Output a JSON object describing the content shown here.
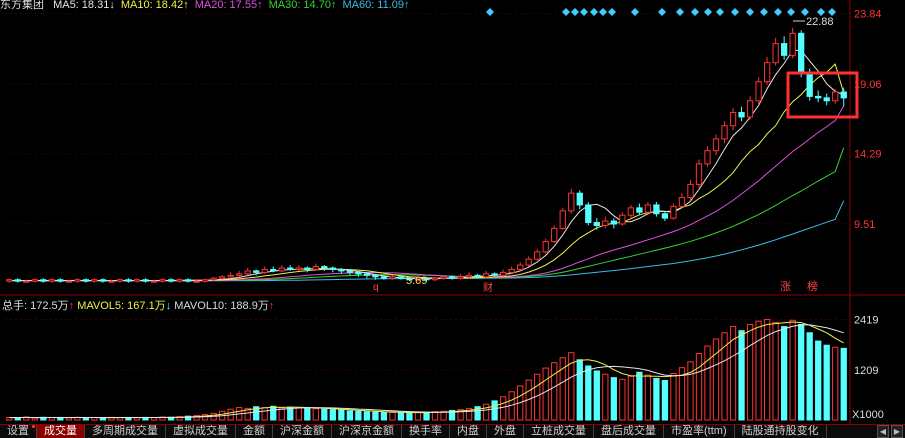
{
  "header": {
    "stock_name": "东方集团",
    "ma_items": [
      {
        "label": "MA5:",
        "value": "18.31",
        "arrow": "↓",
        "color": "#e6e6e6"
      },
      {
        "label": "MA10:",
        "value": "18.42",
        "arrow": "↑",
        "color": "#f0f04a"
      },
      {
        "label": "MA20:",
        "value": "17.55",
        "arrow": "↑",
        "color": "#e050e0"
      },
      {
        "label": "MA30:",
        "value": "14.70",
        "arrow": "↑",
        "color": "#33d633"
      },
      {
        "label": "MA60:",
        "value": "11.09",
        "arrow": "↑",
        "color": "#3fbbe6"
      }
    ]
  },
  "volume_header": {
    "total_label": "总手:",
    "total_value": "172.5万",
    "total_arrow": "↑",
    "mavol5_label": "MAVOL5:",
    "mavol5_value": "167.1万",
    "mavol5_arrow": "↓",
    "mavol10_label": "MAVOL10:",
    "mavol10_value": "188.9万",
    "mavol10_arrow": "↑"
  },
  "markers": {
    "high": "22.88",
    "low": "5.69",
    "tag_q": "q",
    "tag_cai": "财",
    "tag_zhang": "涨",
    "tag_bang": "榜"
  },
  "price_axis": [
    "23.84",
    "19.06",
    "14.29",
    "9.51"
  ],
  "volume_axis": [
    "2419",
    "1209",
    "X1000"
  ],
  "colors": {
    "up": "#ff3333",
    "down": "#54ffff",
    "ma5": "#e6e6e6",
    "ma10": "#f0f04a",
    "ma20": "#e050e0",
    "ma30": "#33d633",
    "ma60": "#3fbbe6",
    "axis": "#8a0000",
    "highlight": "#ff3030"
  },
  "tabs": [
    {
      "label": "设置",
      "active": false,
      "dot": true
    },
    {
      "label": "成交量",
      "active": true,
      "dot": false
    },
    {
      "label": "多周期成交量",
      "active": false,
      "dot": false
    },
    {
      "label": "虚拟成交量",
      "active": false,
      "dot": false
    },
    {
      "label": "金额",
      "active": false,
      "dot": false
    },
    {
      "label": "沪深金额",
      "active": false,
      "dot": false
    },
    {
      "label": "沪深京金额",
      "active": false,
      "dot": false
    },
    {
      "label": "换手率",
      "active": false,
      "dot": false
    },
    {
      "label": "内盘",
      "active": false,
      "dot": false
    },
    {
      "label": "外盘",
      "active": false,
      "dot": false
    },
    {
      "label": "立桩成交量",
      "active": false,
      "dot": false
    },
    {
      "label": "盘后成交量",
      "active": false,
      "dot": false
    },
    {
      "label": "市盈率(ttm)",
      "active": false,
      "dot": false
    },
    {
      "label": "陆股通持股变化",
      "active": false,
      "dot": false
    }
  ],
  "chart_data": {
    "type": "candlestick",
    "price_ylim": [
      5.0,
      24.5
    ],
    "volume_ylim": [
      0,
      2600
    ],
    "volume_unit": "X1000",
    "candles": [
      [
        5.6,
        5.7,
        5.8,
        5.5
      ],
      [
        5.7,
        5.6,
        5.8,
        5.5
      ],
      [
        5.6,
        5.6,
        5.7,
        5.5
      ],
      [
        5.6,
        5.7,
        5.8,
        5.5
      ],
      [
        5.7,
        5.6,
        5.8,
        5.5
      ],
      [
        5.6,
        5.7,
        5.8,
        5.5
      ],
      [
        5.7,
        5.6,
        5.8,
        5.5
      ],
      [
        5.6,
        5.6,
        5.7,
        5.5
      ],
      [
        5.6,
        5.7,
        5.8,
        5.5
      ],
      [
        5.7,
        5.6,
        5.8,
        5.5
      ],
      [
        5.6,
        5.7,
        5.8,
        5.5
      ],
      [
        5.7,
        5.6,
        5.8,
        5.5
      ],
      [
        5.6,
        5.6,
        5.7,
        5.5
      ],
      [
        5.6,
        5.7,
        5.8,
        5.5
      ],
      [
        5.7,
        5.6,
        5.8,
        5.5
      ],
      [
        5.6,
        5.7,
        5.8,
        5.5
      ],
      [
        5.7,
        5.6,
        5.8,
        5.5
      ],
      [
        5.6,
        5.6,
        5.7,
        5.5
      ],
      [
        5.6,
        5.7,
        5.8,
        5.5
      ],
      [
        5.7,
        5.6,
        5.8,
        5.5
      ],
      [
        5.6,
        5.7,
        5.8,
        5.5
      ],
      [
        5.7,
        5.6,
        5.8,
        5.5
      ],
      [
        5.6,
        5.6,
        5.7,
        5.5
      ],
      [
        5.6,
        5.7,
        5.8,
        5.5
      ],
      [
        5.7,
        5.8,
        5.9,
        5.6
      ],
      [
        5.8,
        5.9,
        6.0,
        5.7
      ],
      [
        5.9,
        6.0,
        6.2,
        5.8
      ],
      [
        6.0,
        6.1,
        6.3,
        5.9
      ],
      [
        6.1,
        6.3,
        6.5,
        6.0
      ],
      [
        6.3,
        6.2,
        6.4,
        6.0
      ],
      [
        6.2,
        6.4,
        6.6,
        6.1
      ],
      [
        6.4,
        6.3,
        6.6,
        6.2
      ],
      [
        6.3,
        6.5,
        6.7,
        6.2
      ],
      [
        6.5,
        6.4,
        6.7,
        6.3
      ],
      [
        6.4,
        6.5,
        6.7,
        6.3
      ],
      [
        6.5,
        6.4,
        6.6,
        6.2
      ],
      [
        6.4,
        6.6,
        6.8,
        6.3
      ],
      [
        6.6,
        6.5,
        6.7,
        6.3
      ],
      [
        6.5,
        6.4,
        6.6,
        6.2
      ],
      [
        6.4,
        6.3,
        6.5,
        6.1
      ],
      [
        6.3,
        6.2,
        6.4,
        6.0
      ],
      [
        6.2,
        6.1,
        6.3,
        5.9
      ],
      [
        6.1,
        6.0,
        6.2,
        5.8
      ],
      [
        6.0,
        5.9,
        6.1,
        5.7
      ],
      [
        5.9,
        5.8,
        6.0,
        5.7
      ],
      [
        5.8,
        5.9,
        6.0,
        5.7
      ],
      [
        5.9,
        5.8,
        6.0,
        5.7
      ],
      [
        5.8,
        5.7,
        5.9,
        5.6
      ],
      [
        5.7,
        5.8,
        5.9,
        5.6
      ],
      [
        5.8,
        5.7,
        5.9,
        5.6
      ],
      [
        5.7,
        5.8,
        5.9,
        5.6
      ],
      [
        5.8,
        5.9,
        6.0,
        5.7
      ],
      [
        5.9,
        5.8,
        6.0,
        5.7
      ],
      [
        5.8,
        5.9,
        6.1,
        5.7
      ],
      [
        5.9,
        6.0,
        6.2,
        5.8
      ],
      [
        6.0,
        5.9,
        6.1,
        5.8
      ],
      [
        5.9,
        6.1,
        6.3,
        5.8
      ],
      [
        6.1,
        6.0,
        6.2,
        5.9
      ],
      [
        6.0,
        6.2,
        6.4,
        5.9
      ],
      [
        6.2,
        6.4,
        6.6,
        6.1
      ],
      [
        6.4,
        6.7,
        6.9,
        6.3
      ],
      [
        6.7,
        7.1,
        7.3,
        6.6
      ],
      [
        7.1,
        7.6,
        7.8,
        7.0
      ],
      [
        7.6,
        8.3,
        8.5,
        7.5
      ],
      [
        8.3,
        9.2,
        9.4,
        8.2
      ],
      [
        9.2,
        10.4,
        10.6,
        9.1
      ],
      [
        10.4,
        11.6,
        11.9,
        10.2
      ],
      [
        11.6,
        10.8,
        11.8,
        10.5
      ],
      [
        10.8,
        9.6,
        11.0,
        9.4
      ],
      [
        9.6,
        9.4,
        9.9,
        9.1
      ],
      [
        9.4,
        9.7,
        10.0,
        9.2
      ],
      [
        9.7,
        9.5,
        9.9,
        9.2
      ],
      [
        9.5,
        10.1,
        10.3,
        9.4
      ],
      [
        10.1,
        10.6,
        10.8,
        9.9
      ],
      [
        10.6,
        10.3,
        10.9,
        10.1
      ],
      [
        10.3,
        10.8,
        11.0,
        10.1
      ],
      [
        10.8,
        10.2,
        11.0,
        10.0
      ],
      [
        10.2,
        9.9,
        10.4,
        9.7
      ],
      [
        9.9,
        10.7,
        10.9,
        9.8
      ],
      [
        10.7,
        11.3,
        11.6,
        10.6
      ],
      [
        11.3,
        12.2,
        12.5,
        11.1
      ],
      [
        12.2,
        13.6,
        13.9,
        12.0
      ],
      [
        13.6,
        14.5,
        14.8,
        13.4
      ],
      [
        14.5,
        15.3,
        15.6,
        14.2
      ],
      [
        15.3,
        16.2,
        16.5,
        15.0
      ],
      [
        16.2,
        17.1,
        17.4,
        15.9
      ],
      [
        17.1,
        16.8,
        17.5,
        16.5
      ],
      [
        16.8,
        17.9,
        18.2,
        16.6
      ],
      [
        17.9,
        19.2,
        19.5,
        17.7
      ],
      [
        19.2,
        20.5,
        20.9,
        19.0
      ],
      [
        20.5,
        21.8,
        22.2,
        20.3
      ],
      [
        21.8,
        21.0,
        22.3,
        20.7
      ],
      [
        21.0,
        22.5,
        22.88,
        20.8
      ],
      [
        22.5,
        19.8,
        22.7,
        19.5
      ],
      [
        19.8,
        18.2,
        20.1,
        17.9
      ],
      [
        18.2,
        18.1,
        18.6,
        17.8
      ],
      [
        18.1,
        17.9,
        18.4,
        17.6
      ],
      [
        17.9,
        18.5,
        18.7,
        17.7
      ],
      [
        18.5,
        18.1,
        18.8,
        17.5
      ]
    ],
    "volumes": [
      60,
      55,
      70,
      50,
      65,
      58,
      62,
      54,
      66,
      57,
      60,
      52,
      64,
      59,
      61,
      56,
      63,
      58,
      70,
      66,
      80,
      92,
      110,
      130,
      160,
      210,
      260,
      300,
      280,
      320,
      300,
      330,
      290,
      310,
      300,
      280,
      270,
      260,
      250,
      240,
      220,
      210,
      200,
      190,
      185,
      180,
      175,
      170,
      180,
      190,
      200,
      210,
      230,
      250,
      280,
      320,
      380,
      460,
      560,
      680,
      820,
      960,
      1100,
      1250,
      1380,
      1500,
      1620,
      1450,
      1300,
      1180,
      1100,
      1020,
      980,
      1050,
      1150,
      1080,
      1000,
      950,
      1120,
      1260,
      1400,
      1600,
      1780,
      1950,
      2100,
      2250,
      2150,
      2300,
      2380,
      2419,
      2350,
      2250,
      2400,
      2300,
      2100,
      1900,
      1800,
      1750,
      1725
    ],
    "ma": {
      "ma5": [
        5.65,
        5.65,
        5.65,
        5.65,
        5.65,
        5.65,
        5.65,
        5.65,
        5.65,
        5.65,
        5.65,
        5.65,
        5.65,
        5.65,
        5.65,
        5.65,
        5.65,
        5.65,
        5.65,
        5.65,
        5.66,
        5.66,
        5.66,
        5.67,
        5.68,
        5.72,
        5.78,
        5.86,
        5.98,
        6.1,
        6.2,
        6.28,
        6.36,
        6.4,
        6.42,
        6.44,
        6.46,
        6.46,
        6.44,
        6.4,
        6.34,
        6.26,
        6.16,
        6.06,
        5.96,
        5.88,
        5.84,
        5.8,
        5.78,
        5.78,
        5.78,
        5.8,
        5.82,
        5.84,
        5.88,
        5.92,
        5.96,
        6.0,
        6.06,
        6.14,
        6.3,
        6.56,
        6.9,
        7.36,
        7.98,
        8.74,
        9.66,
        10.36,
        10.76,
        10.84,
        10.58,
        10.06,
        9.66,
        9.66,
        9.88,
        10.2,
        10.4,
        10.36,
        10.3,
        10.62,
        11.06,
        11.86,
        12.74,
        13.62,
        14.6,
        15.52,
        16.06,
        16.78,
        17.58,
        18.72,
        19.68,
        20.44,
        21.36,
        21.32,
        20.62,
        19.92,
        19.06,
        18.54,
        18.31
      ],
      "ma10": [
        5.65,
        5.65,
        5.65,
        5.65,
        5.65,
        5.65,
        5.65,
        5.65,
        5.65,
        5.65,
        5.65,
        5.65,
        5.65,
        5.65,
        5.65,
        5.65,
        5.65,
        5.65,
        5.65,
        5.65,
        5.65,
        5.65,
        5.66,
        5.66,
        5.67,
        5.69,
        5.72,
        5.76,
        5.82,
        5.88,
        5.96,
        6.03,
        6.11,
        6.19,
        6.26,
        6.32,
        6.37,
        6.41,
        6.42,
        6.41,
        6.39,
        6.36,
        6.31,
        6.23,
        6.14,
        6.05,
        5.97,
        5.91,
        5.87,
        5.84,
        5.82,
        5.81,
        5.81,
        5.81,
        5.82,
        5.84,
        5.86,
        5.89,
        5.92,
        5.96,
        6.06,
        6.22,
        6.43,
        6.7,
        7.06,
        7.51,
        8.07,
        8.55,
        8.9,
        9.24,
        9.44,
        9.56,
        9.61,
        9.86,
        10.13,
        10.27,
        10.36,
        10.35,
        10.38,
        10.63,
        10.81,
        11.24,
        11.55,
        11.96,
        12.43,
        13.0,
        13.8,
        14.44,
        14.92,
        15.64,
        16.2,
        17.14,
        17.84,
        18.32,
        18.98,
        19.48,
        19.84,
        20.4,
        18.42
      ],
      "ma20": [
        5.64,
        5.64,
        5.64,
        5.64,
        5.64,
        5.64,
        5.64,
        5.64,
        5.64,
        5.64,
        5.64,
        5.64,
        5.64,
        5.64,
        5.64,
        5.64,
        5.64,
        5.64,
        5.64,
        5.64,
        5.64,
        5.64,
        5.64,
        5.65,
        5.65,
        5.66,
        5.67,
        5.69,
        5.71,
        5.74,
        5.77,
        5.81,
        5.85,
        5.9,
        5.95,
        6.0,
        6.04,
        6.08,
        6.11,
        6.14,
        6.16,
        6.18,
        6.19,
        6.19,
        6.18,
        6.17,
        6.14,
        6.11,
        6.07,
        6.03,
        6.0,
        5.96,
        5.93,
        5.9,
        5.88,
        5.86,
        5.85,
        5.85,
        5.86,
        5.88,
        5.92,
        5.98,
        6.06,
        6.16,
        6.3,
        6.47,
        6.69,
        6.92,
        7.13,
        7.35,
        7.55,
        7.73,
        7.89,
        8.06,
        8.24,
        8.42,
        8.6,
        8.79,
        8.98,
        9.21,
        9.45,
        9.75,
        10.05,
        10.36,
        10.73,
        11.11,
        11.55,
        12.0,
        12.44,
        12.95,
        13.44,
        13.94,
        14.44,
        14.86,
        15.3,
        15.74,
        16.14,
        16.56,
        17.55
      ],
      "ma30": [
        5.64,
        5.64,
        5.64,
        5.64,
        5.64,
        5.64,
        5.64,
        5.64,
        5.64,
        5.64,
        5.64,
        5.64,
        5.64,
        5.64,
        5.64,
        5.64,
        5.64,
        5.64,
        5.64,
        5.64,
        5.64,
        5.64,
        5.64,
        5.64,
        5.64,
        5.65,
        5.65,
        5.66,
        5.67,
        5.69,
        5.71,
        5.73,
        5.75,
        5.78,
        5.81,
        5.84,
        5.87,
        5.9,
        5.93,
        5.96,
        5.98,
        6.0,
        6.02,
        6.03,
        6.04,
        6.04,
        6.04,
        6.03,
        6.02,
        6.01,
        5.99,
        5.97,
        5.95,
        5.93,
        5.91,
        5.9,
        5.89,
        5.88,
        5.88,
        5.88,
        5.9,
        5.93,
        5.97,
        6.03,
        6.11,
        6.21,
        6.33,
        6.47,
        6.61,
        6.75,
        6.89,
        7.03,
        7.16,
        7.3,
        7.44,
        7.58,
        7.72,
        7.86,
        8.0,
        8.16,
        8.32,
        8.5,
        8.69,
        8.89,
        9.11,
        9.34,
        9.6,
        9.87,
        10.14,
        10.45,
        10.77,
        11.1,
        11.44,
        11.76,
        12.09,
        12.43,
        12.75,
        13.08,
        14.7
      ],
      "ma60": [
        5.63,
        5.63,
        5.63,
        5.63,
        5.63,
        5.63,
        5.63,
        5.63,
        5.63,
        5.63,
        5.63,
        5.63,
        5.63,
        5.63,
        5.63,
        5.63,
        5.63,
        5.63,
        5.63,
        5.63,
        5.63,
        5.63,
        5.63,
        5.63,
        5.63,
        5.63,
        5.63,
        5.64,
        5.64,
        5.64,
        5.65,
        5.65,
        5.66,
        5.66,
        5.67,
        5.68,
        5.69,
        5.7,
        5.71,
        5.72,
        5.73,
        5.74,
        5.75,
        5.76,
        5.77,
        5.77,
        5.78,
        5.78,
        5.79,
        5.79,
        5.79,
        5.8,
        5.8,
        5.8,
        5.8,
        5.8,
        5.81,
        5.81,
        5.81,
        5.82,
        5.83,
        5.85,
        5.87,
        5.9,
        5.94,
        5.98,
        6.03,
        6.09,
        6.15,
        6.21,
        6.27,
        6.33,
        6.39,
        6.46,
        6.53,
        6.6,
        6.67,
        6.74,
        6.81,
        6.9,
        6.99,
        7.09,
        7.2,
        7.32,
        7.45,
        7.59,
        7.74,
        7.9,
        8.06,
        8.24,
        8.42,
        8.62,
        8.82,
        9.02,
        9.22,
        9.42,
        9.62,
        9.82,
        11.09
      ]
    }
  }
}
